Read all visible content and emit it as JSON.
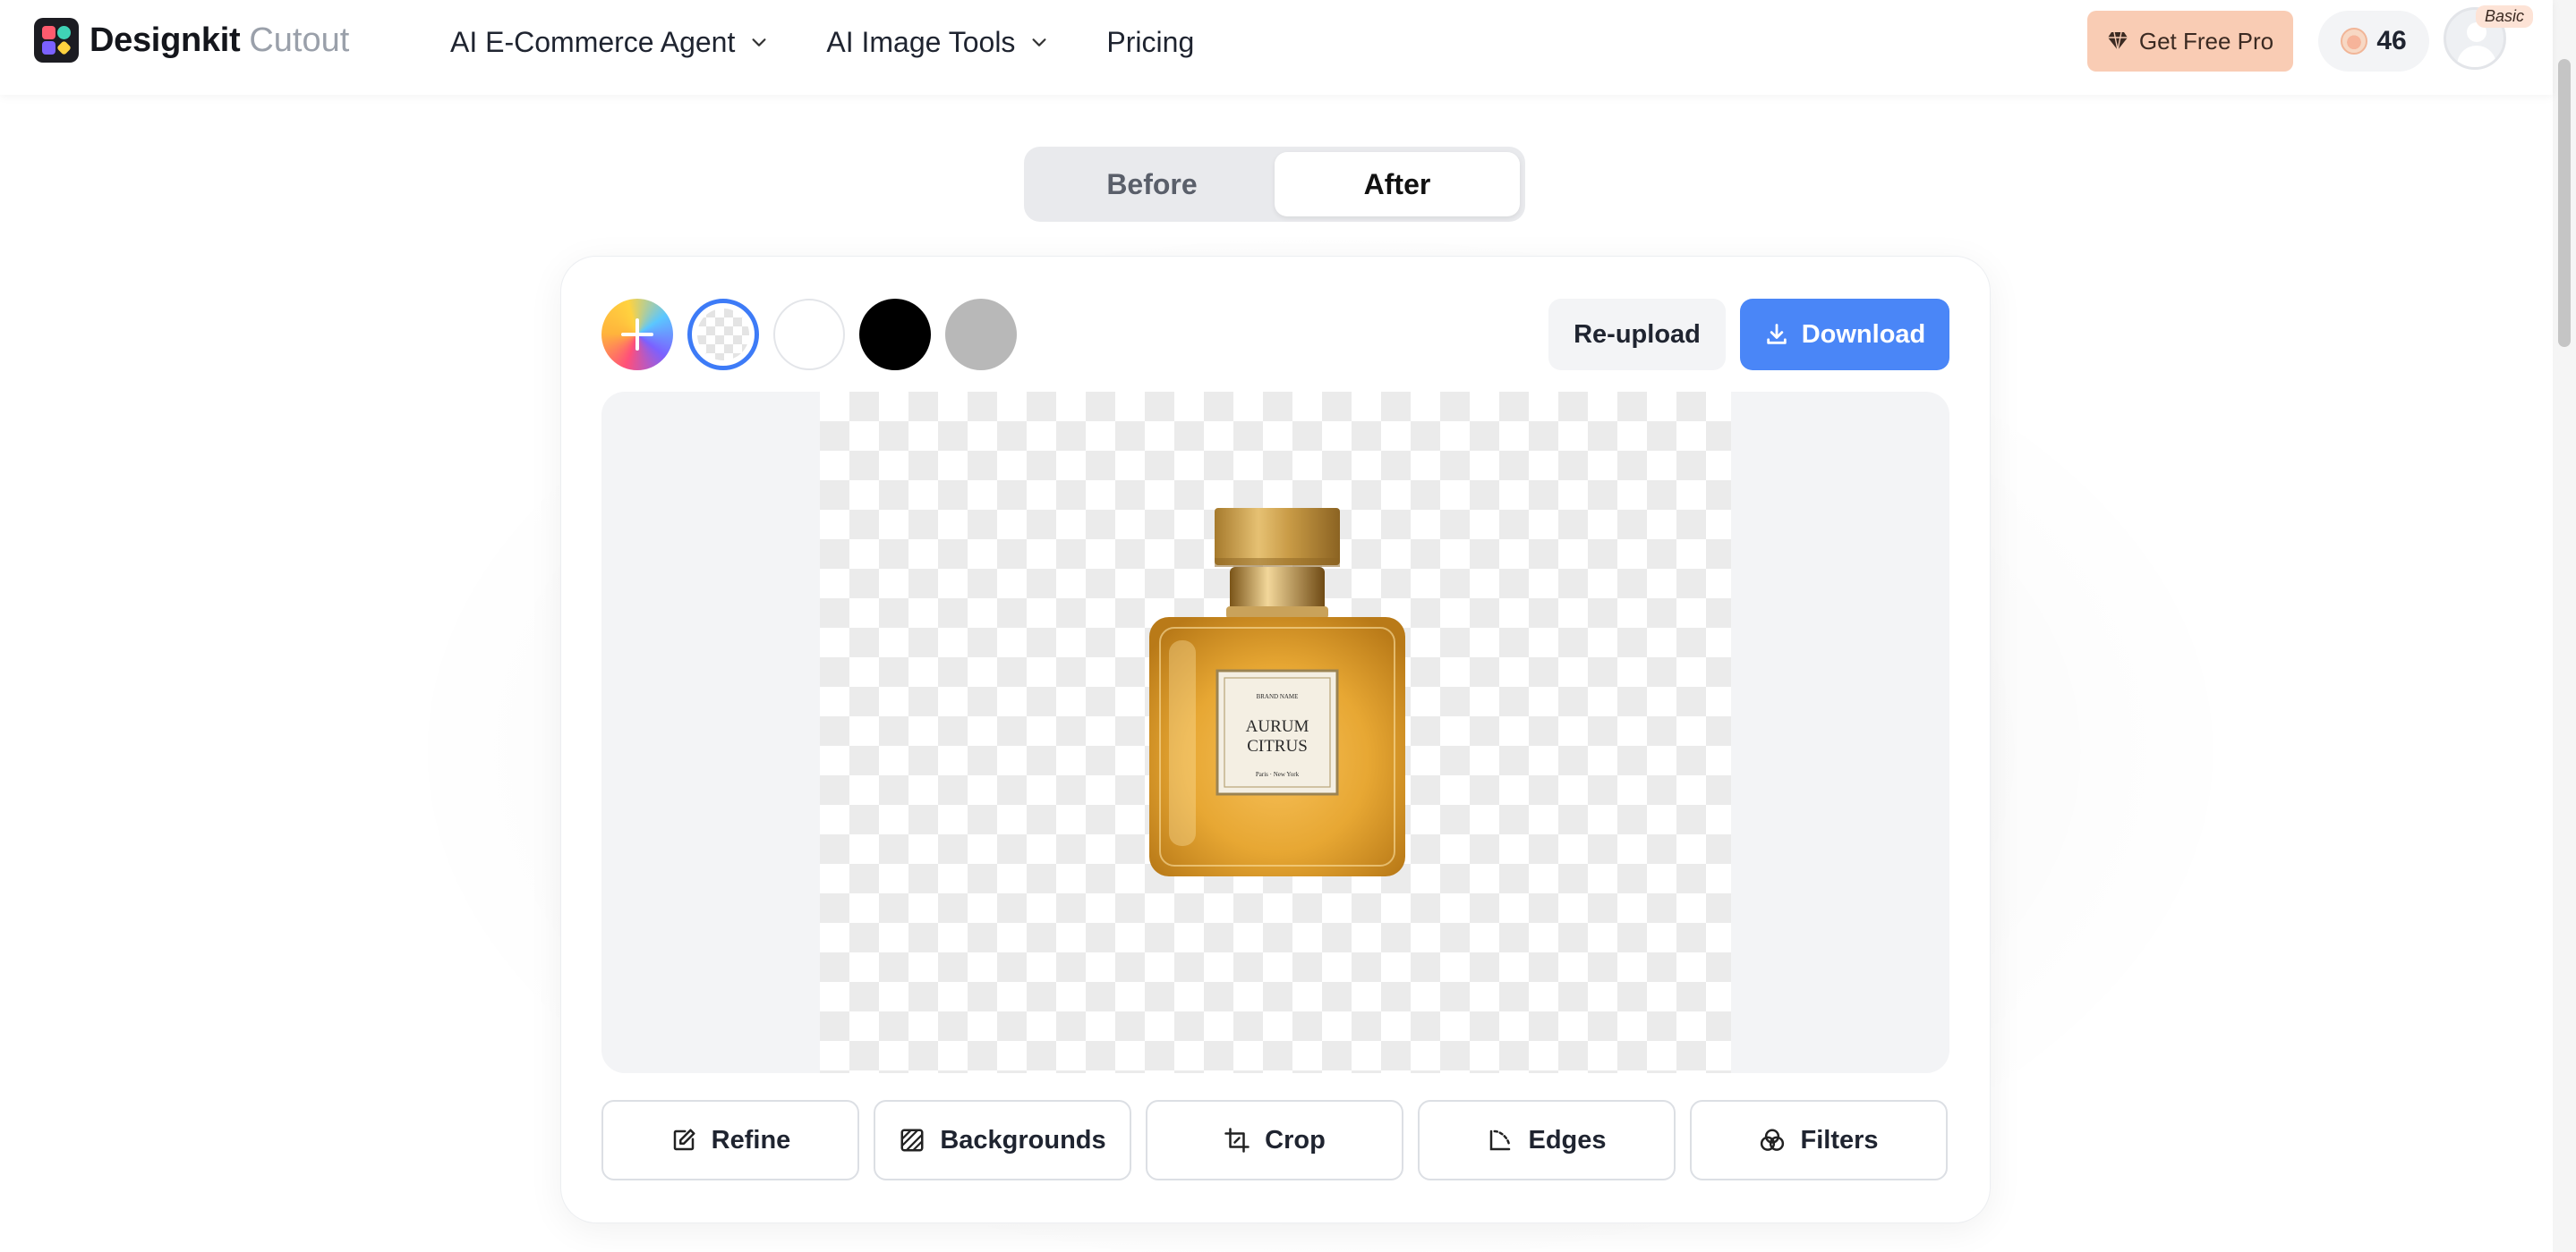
{
  "header": {
    "brand": "Designkit",
    "product": "Cutout",
    "nav": [
      {
        "label": "AI E-Commerce Agent"
      },
      {
        "label": "AI Image Tools"
      },
      {
        "label": "Pricing"
      }
    ],
    "pro_button": "Get Free Pro",
    "credits": "46",
    "plan_badge": "Basic"
  },
  "toggle": {
    "before": "Before",
    "after": "After",
    "selected": "After"
  },
  "toolbar": {
    "swatches": [
      "custom-color",
      "transparent",
      "white",
      "black",
      "gray"
    ],
    "swatch_colors": {
      "white": "#ffffff",
      "black": "#000000",
      "gray": "#b8b8b8"
    },
    "selected_swatch": "transparent",
    "reupload_label": "Re-upload",
    "download_label": "Download"
  },
  "product_label": {
    "brand_line": "BRAND NAME",
    "name_line1": "AURUM",
    "name_line2": "CITRUS",
    "cities": "Paris · New York"
  },
  "tools": [
    {
      "label": "Refine",
      "icon": "edit-icon"
    },
    {
      "label": "Backgrounds",
      "icon": "pattern-icon"
    },
    {
      "label": "Crop",
      "icon": "crop-icon"
    },
    {
      "label": "Edges",
      "icon": "edges-icon"
    },
    {
      "label": "Filters",
      "icon": "filters-icon"
    }
  ],
  "colors": {
    "accent": "#4a86f7",
    "selected_ring": "#3d7bf7",
    "pro_button_bg": "#f9ccb4"
  }
}
